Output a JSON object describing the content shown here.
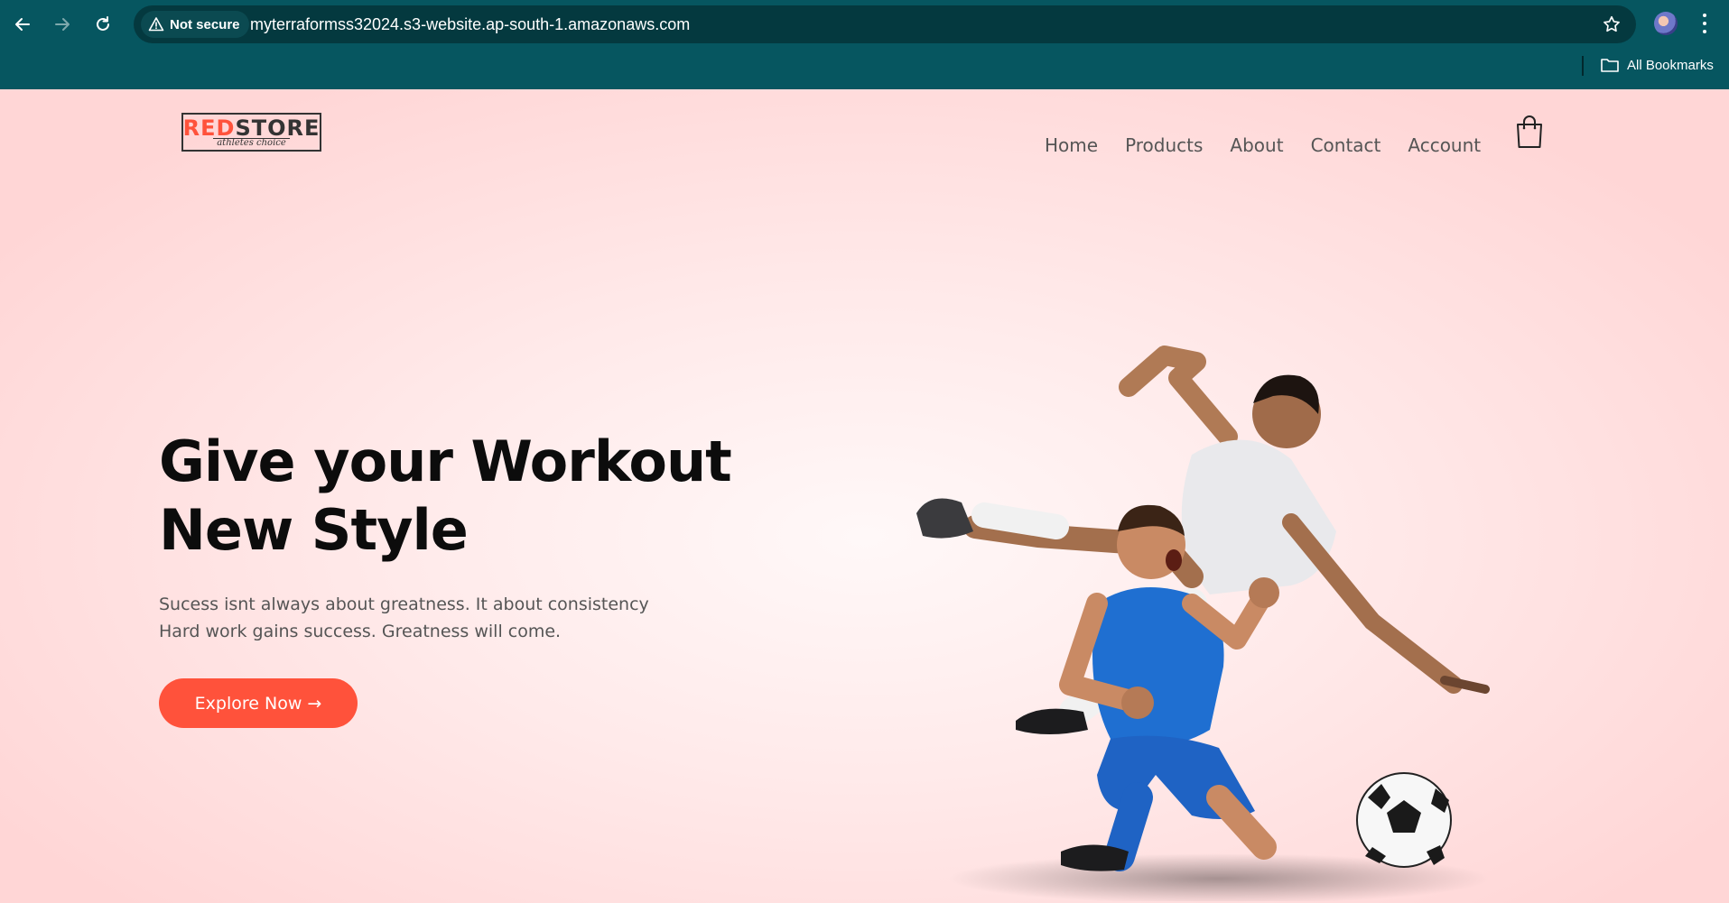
{
  "browser": {
    "security_label": "Not secure",
    "url": "myterraformss32024.s3-website.ap-south-1.amazonaws.com",
    "bookmarks_label": "All Bookmarks"
  },
  "site": {
    "logo": {
      "part1": "RED",
      "part2": "STORE",
      "tagline": "athletes choice"
    },
    "nav": [
      "Home",
      "Products",
      "About",
      "Contact",
      "Account"
    ]
  },
  "hero": {
    "title_lines": [
      "Give your Workout",
      "New Style"
    ],
    "subtitle_lines": [
      "Sucess isnt always about greatness. It about consistency",
      "Hard work gains success. Greatness will come."
    ],
    "cta_label": "Explore Now →"
  },
  "colors": {
    "chrome": "#065660",
    "omnibox": "#04393f",
    "brand_red": "#ff523b",
    "text_dark": "#0c0c0c",
    "text_muted": "#555555",
    "page_bg": "#ffe3e3"
  },
  "icons": [
    "back-arrow-icon",
    "forward-arrow-icon",
    "reload-icon",
    "warning-triangle-icon",
    "star-icon",
    "profile-avatar",
    "more-vert-icon",
    "folder-icon",
    "shopping-bag-icon"
  ]
}
